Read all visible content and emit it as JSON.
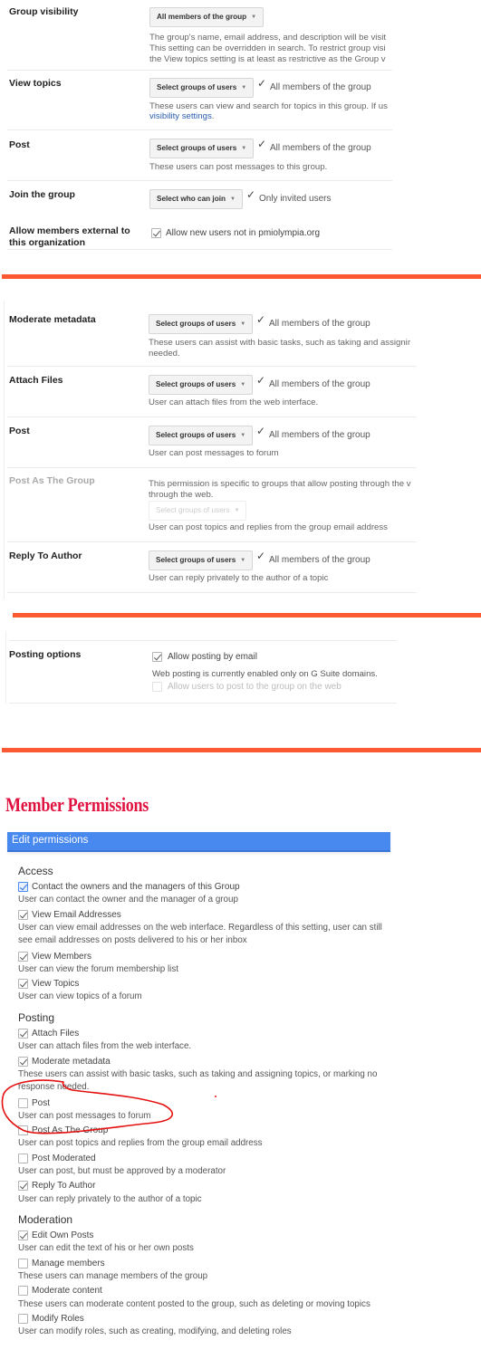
{
  "panel1": {
    "rows": [
      {
        "label": "Group visibility",
        "dropdown": "All members of the group",
        "desc_lines": [
          "The group's name, email address, and description will be visit",
          "This setting can be overridden in search. To restrict group visi",
          "the View topics setting is at least as restrictive as the Group v"
        ]
      },
      {
        "label": "View topics",
        "dropdown": "Select groups of users",
        "status": "All members of the group",
        "desc_lines": [
          "These users can view and search for topics in this group. If us"
        ],
        "link": "visibility settings",
        "link_suffix": "."
      },
      {
        "label": "Post",
        "dropdown": "Select groups of users",
        "status": "All members of the group",
        "desc_lines": [
          "These users can post messages to this group."
        ]
      },
      {
        "label": "Join the group",
        "dropdown": "Select who can join",
        "status": "Only invited users"
      },
      {
        "label_lines": [
          "Allow members external to",
          "this organization"
        ],
        "checkbox_label": "Allow new users not in pmiolympia.org",
        "checked": true
      }
    ]
  },
  "panel2": {
    "rows": [
      {
        "label": "Moderate metadata",
        "dropdown": "Select groups of users",
        "status": "All members of the group",
        "desc_lines": [
          "These users can assist with basic tasks, such as taking and assignir",
          "needed."
        ]
      },
      {
        "label": "Attach Files",
        "dropdown": "Select groups of users",
        "status": "All members of the group",
        "desc_lines": [
          "User can attach files from the web interface."
        ]
      },
      {
        "label": "Post",
        "dropdown": "Select groups of users",
        "status": "All members of the group",
        "desc_lines": [
          "User can post messages to forum"
        ]
      },
      {
        "label": "Post As The Group",
        "disabled": true,
        "pre_lines": [
          "This permission is specific to groups that allow posting through the v",
          "through the web."
        ],
        "dropdown": "Select groups of users",
        "desc_lines": [
          "User can post topics and replies from the group email address"
        ]
      },
      {
        "label": "Reply To Author",
        "dropdown": "Select groups of users",
        "status": "All members of the group",
        "desc_lines": [
          "User can reply privately to the author of a topic"
        ]
      }
    ]
  },
  "panel3": {
    "label": "Posting options",
    "checkbox1": {
      "label": "Allow posting by email",
      "checked": true
    },
    "note": "Web posting is currently enabled only on G Suite domains.",
    "checkbox2": {
      "label": "Allow users to post to the group on the web",
      "checked": false,
      "disabled": true
    }
  },
  "member_permissions": {
    "title": "Member Permissions",
    "header": "Edit permissions",
    "sections": [
      {
        "name": "Access",
        "items": [
          {
            "label": "Contact the owners and the managers of this Group",
            "checked": true,
            "highlight": true,
            "desc": "User can contact the owner and the manager of a group"
          },
          {
            "label": "View Email Addresses",
            "checked": true,
            "desc": "User can view email addresses on the web interface. Regardless of this setting, user can still see email addresses on posts delivered to his or her inbox"
          },
          {
            "label": "View Members",
            "checked": true,
            "desc": "User can view the forum membership list"
          },
          {
            "label": "View Topics",
            "checked": true,
            "desc": "User can view topics of a forum"
          }
        ]
      },
      {
        "name": "Posting",
        "items": [
          {
            "label": "Attach Files",
            "checked": true,
            "desc": "User can attach files from the web interface."
          },
          {
            "label": "Moderate metadata",
            "checked": true,
            "desc": "These users can assist with basic tasks, such as taking and assigning topics, or marking no response needed."
          },
          {
            "label": "Post",
            "checked": false,
            "desc": "User can post messages to forum"
          },
          {
            "label": "Post As The Group",
            "checked": false,
            "desc": "User can post topics and replies from the group email address"
          },
          {
            "label": "Post Moderated",
            "checked": false,
            "desc": "User can post, but must be approved by a moderator"
          },
          {
            "label": "Reply To Author",
            "checked": true,
            "desc": "User can reply privately to the author of a topic"
          }
        ]
      },
      {
        "name": "Moderation",
        "items": [
          {
            "label": "Edit Own Posts",
            "checked": true,
            "desc": "User can edit the text of his or her own posts"
          },
          {
            "label": "Manage members",
            "checked": false,
            "desc": "These users can manage members of the group"
          },
          {
            "label": "Moderate content",
            "checked": false,
            "desc": "These users can moderate content posted to the group, such as deleting or moving topics"
          },
          {
            "label": "Modify Roles",
            "checked": false,
            "desc": "User can modify roles, such as creating, modifying, and deleting roles"
          }
        ]
      }
    ]
  },
  "colors": {
    "divider_orange": "#fd5a34",
    "header_blue": "#4889f0",
    "title_red": "#e0123f",
    "annotation_red": "#e51010",
    "link_blue": "#2a5db0"
  }
}
